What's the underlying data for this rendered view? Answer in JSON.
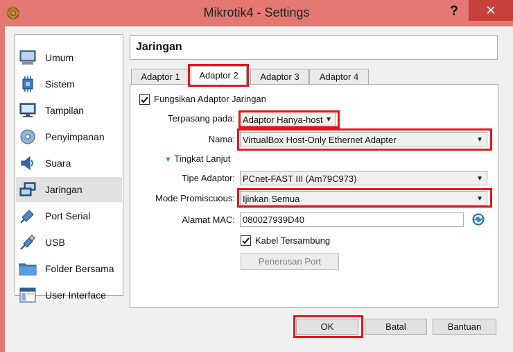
{
  "window": {
    "title": "Mikrotik4 - Settings",
    "help_label": "?",
    "close_label": "✕"
  },
  "sidebar": {
    "items": [
      {
        "label": "Umum",
        "icon": "general-icon"
      },
      {
        "label": "Sistem",
        "icon": "system-icon"
      },
      {
        "label": "Tampilan",
        "icon": "display-icon"
      },
      {
        "label": "Penyimpanan",
        "icon": "storage-icon"
      },
      {
        "label": "Suara",
        "icon": "audio-icon"
      },
      {
        "label": "Jaringan",
        "icon": "network-icon",
        "selected": true
      },
      {
        "label": "Port Serial",
        "icon": "serial-port-icon"
      },
      {
        "label": "USB",
        "icon": "usb-icon"
      },
      {
        "label": "Folder Bersama",
        "icon": "shared-folder-icon"
      },
      {
        "label": "User Interface",
        "icon": "user-interface-icon"
      }
    ]
  },
  "header": {
    "title": "Jaringan"
  },
  "tabs": [
    {
      "label": "Adaptor 1"
    },
    {
      "label": "Adaptor 2",
      "active": true
    },
    {
      "label": "Adaptor 3"
    },
    {
      "label": "Adaptor 4"
    }
  ],
  "adapter": {
    "enable_label": "Fungsikan Adaptor Jaringan",
    "enabled": true,
    "attached_label": "Terpasang pada:",
    "attached_value": "Adaptor Hanya-host",
    "name_label": "Nama:",
    "name_value": "VirtualBox Host-Only Ethernet Adapter",
    "advanced_label": "Tingkat Lanjut",
    "type_label": "Tipe Adaptor:",
    "type_value": "PCnet-FAST III (Am79C973)",
    "promisc_label": "Mode Promiscuous:",
    "promisc_value": "Ijinkan Semua",
    "mac_label": "Alamat MAC:",
    "mac_value": "080027939D40",
    "cable_label": "Kabel Tersambung",
    "cable_connected": true,
    "port_forward_label": "Penerusan Port"
  },
  "footer": {
    "ok_label": "OK",
    "cancel_label": "Batal",
    "help_label": "Bantuan"
  },
  "colors": {
    "title_bar": "#e57873",
    "close_button": "#c7403a",
    "highlight": "#e8141b"
  }
}
